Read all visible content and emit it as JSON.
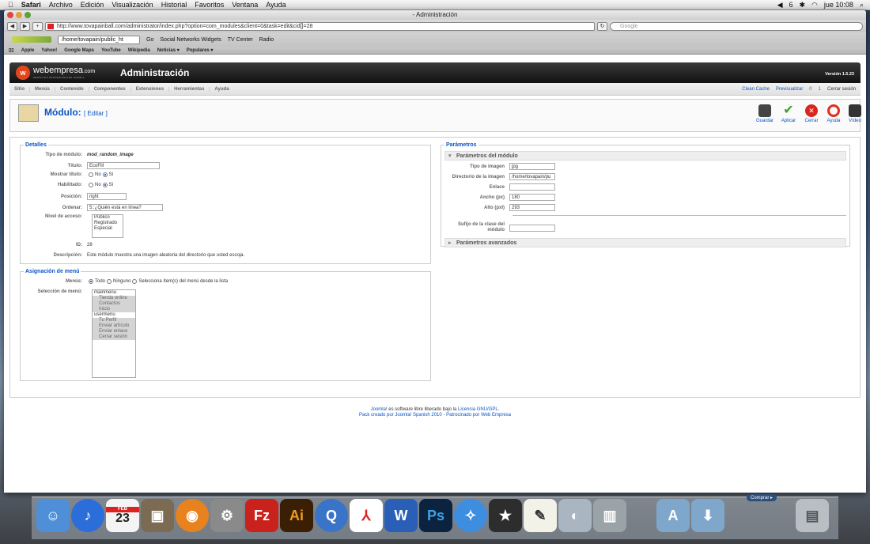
{
  "menubar": {
    "apple": "",
    "app": "Safari",
    "items": [
      "Archivo",
      "Edición",
      "Visualización",
      "Historial",
      "Favoritos",
      "Ventana",
      "Ayuda"
    ],
    "battery": "6",
    "clock": "jue 10:08"
  },
  "browser": {
    "title": "- Administración",
    "url": "http://www.tovapainball.com/administrator/index.php?option=com_modules&client=0&task=edit&cid[]=28",
    "search_placeholder": "Google",
    "path_box": "/home/tovapain/public_ht",
    "go": "Go",
    "toolbar": [
      "Social Networks Widgets",
      "TV Center"
    ],
    "radio": "Radio",
    "bookmarks": [
      "Apple",
      "Yahoo!",
      "Google Maps",
      "YouTube",
      "Wikipedia",
      "Noticias ▾",
      "Populares ▾"
    ]
  },
  "header": {
    "logo_letter": "w",
    "brand": "webempresa",
    "brand_suffix": ".com",
    "brand_sub": "SERVICIOS PROFESIONALES JOOMLA",
    "title": "Administración",
    "version": "Versión 1.5.23"
  },
  "nav": {
    "items": [
      "Sitio",
      "Menús",
      "Contenido",
      "Componentes",
      "Extensiones",
      "Herramientas",
      "Ayuda"
    ],
    "right": [
      "Clean Cache",
      "Previsualizar",
      "0",
      "1",
      "Cerrar sesión"
    ]
  },
  "toolbar": {
    "title": "Módulo:",
    "subtitle": "[ Editar ]",
    "buttons": [
      "Guardar",
      "Aplicar",
      "Cerrar",
      "Ayuda",
      "Vídeo"
    ],
    "colors": {
      "guardar": "#444444",
      "aplicar": "#3aa12d",
      "cerrar": "#d9261c",
      "ayuda": "#e0301e",
      "video": "#333333"
    }
  },
  "details": {
    "legend": "Detalles",
    "tipo_label": "Tipo de módulo:",
    "tipo_value": "mod_random_image",
    "titulo_label": "Título:",
    "titulo_value": "EcoFill",
    "mostrar_label": "Mostrar título:",
    "habilitado_label": "Habilitado:",
    "no": "No",
    "si": "Sí",
    "posicion_label": "Posición:",
    "posicion_value": "right",
    "ordenar_label": "Ordenar:",
    "ordenar_value": "5::¿Quién está en línea?",
    "acceso_label": "Nivel de acceso:",
    "acceso_options": [
      "Público",
      "Registrado",
      "Especial"
    ],
    "id_label": "ID:",
    "id_value": "28",
    "desc_label": "Descripción:",
    "desc_value": "Este módulo muestra una imagen aleatoria del directorio que usted escoja."
  },
  "menu_assign": {
    "legend": "Asignación de menú",
    "menus_label": "Menús:",
    "todo": "Todo",
    "ninguno": "Ninguno",
    "selecciona": "Selecciona ítem(s) del menú desde la lista",
    "seleccion_label": "Selección de menú:",
    "items": [
      {
        "t": "mainmenu",
        "s": false,
        "i": false
      },
      {
        "t": "Tienda online",
        "s": true,
        "i": true
      },
      {
        "t": "Contactos",
        "s": true,
        "i": true
      },
      {
        "t": "Inicio",
        "s": true,
        "i": true
      },
      {
        "t": "usermenu",
        "s": false,
        "i": false
      },
      {
        "t": "Tu Perfil",
        "s": true,
        "i": true
      },
      {
        "t": "Enviar artículo",
        "s": true,
        "i": true
      },
      {
        "t": "Enviar enlace",
        "s": true,
        "i": true
      },
      {
        "t": "Cerrar sesión",
        "s": true,
        "i": true
      }
    ]
  },
  "params": {
    "legend": "Parámetros",
    "module_params": "Parámetros del módulo",
    "tipo_label": "Tipo de imagen",
    "tipo_value": "jpg",
    "dir_label": "Directorio de la imagen",
    "dir_value": "/home/tovapain/pu",
    "enlace_label": "Enlace",
    "enlace_value": "",
    "ancho_label": "Ancho (px)",
    "ancho_value": "180",
    "alto_label": "Alto (pxl)",
    "alto_value": "293",
    "sufijo_label1": "Sufijo de la clase del",
    "sufijo_label2": "módulo",
    "advanced": "Parámetros avanzados"
  },
  "footer": {
    "joomla": "Joomla!",
    "line1": " es software libre liberado bajo la ",
    "licencia": "Licencia GNU/GPL.",
    "line2": "Pack creado por Joomla! Spanish 2010 - Patrocinado por Web Empresa"
  },
  "dock": {
    "comprar": "Comprar ▸",
    "calendar_month": "FEB",
    "calendar_day": "23",
    "icons": [
      "Finder",
      "iTunes",
      "iCal",
      "iPhoto",
      "Firefox",
      "Preferencias del Sistema",
      "FileZilla",
      "Illustrator",
      "QuickTime",
      "Acrobat",
      "Word",
      "Photoshop",
      "Safari",
      "iMovie",
      "Vista Previa",
      "Libreta de Direcciones",
      "Papelera reciclaje",
      "Aplicaciones",
      "Descargas",
      "Papelera"
    ]
  }
}
